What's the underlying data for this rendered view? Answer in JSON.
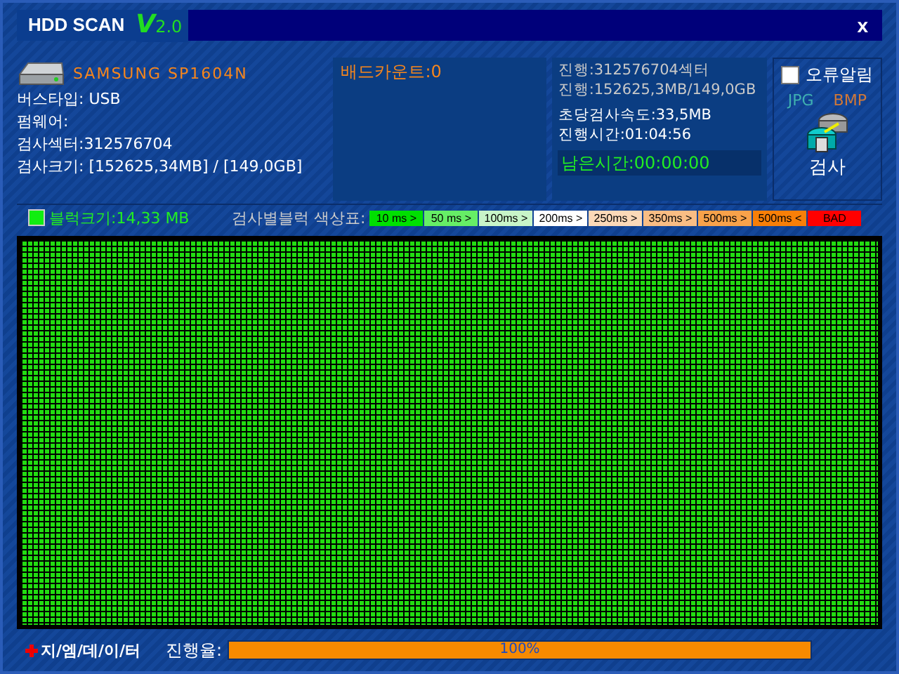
{
  "window": {
    "title": "HDD SCAN",
    "version": "V",
    "version_number": "2.0",
    "close": "x"
  },
  "drive": {
    "model": "SAMSUNG SP1604N",
    "bus_type": "버스타입: USB",
    "firmware": "펌웨어:",
    "sectors": "검사섹터:312576704",
    "size": "검사크기: [152625,34MB] / [149,0GB]"
  },
  "bad_count": "배드카운트:0",
  "progress_info": {
    "sectors": "진행:312576704섹터",
    "size": "진행:152625,3MB/149,0GB",
    "speed": "초당검사속도:33,5MB",
    "elapsed": "진행시간:01:04:56",
    "remaining": "남은시간:00:00:00"
  },
  "error_alarm": {
    "label": "오류알림",
    "checked": false
  },
  "formats": [
    {
      "label": "JPG",
      "color": "#3fb0b0"
    },
    {
      "label": "BMP",
      "color": "#d07838"
    }
  ],
  "scan_button": "검사",
  "block_size": "블럭크기:14,33 MB",
  "legend": {
    "title": "검사별블럭 색상표:",
    "items": [
      {
        "label": "10 ms >",
        "color": "#00e000"
      },
      {
        "label": "50 ms >",
        "color": "#66ee66"
      },
      {
        "label": "100ms >",
        "color": "#c8f5c8"
      },
      {
        "label": "200ms >",
        "color": "#ffffff"
      },
      {
        "label": "250ms >",
        "color": "#fbd9b8"
      },
      {
        "label": "350ms >",
        "color": "#f9bd84"
      },
      {
        "label": "500ms >",
        "color": "#f8a24a"
      },
      {
        "label": "500ms <",
        "color": "#f87f08"
      },
      {
        "label": "BAD",
        "color": "#ff0000"
      }
    ]
  },
  "brand": "지/엠/데/이/터",
  "progress": {
    "label": "진행율:",
    "level": 1.0,
    "reading": "100%"
  }
}
